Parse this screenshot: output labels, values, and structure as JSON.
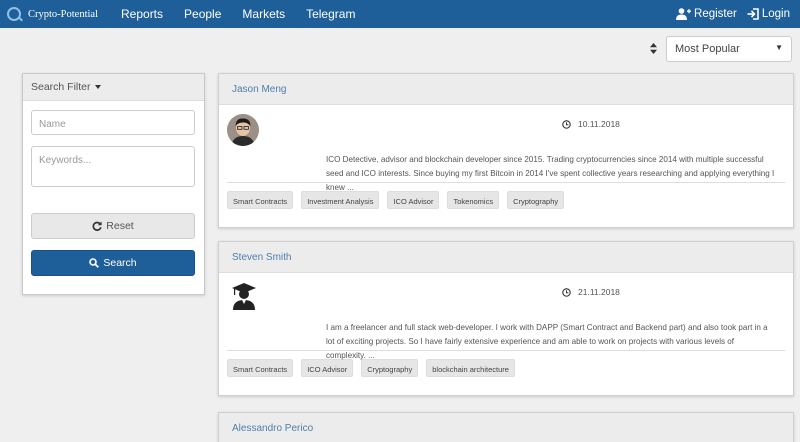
{
  "navbar": {
    "brand": "Crypto-Potential",
    "links": [
      "Reports",
      "People",
      "Markets",
      "Telegram"
    ],
    "register": "Register",
    "login": "Login"
  },
  "sort": {
    "selected": "Most Popular"
  },
  "filter": {
    "title": "Search Filter",
    "name_placeholder": "Name",
    "keywords_placeholder": "Keywords...",
    "reset_label": "Reset",
    "search_label": "Search"
  },
  "cards": [
    {
      "name": "Jason Meng",
      "date": "10.11.2018",
      "description": "ICO Detective, advisor and blockchain developer since 2015. Trading cryptocurrencies since 2014 with multiple successful seed and ICO interests. Since buying my first Bitcoin in 2014 I've spent collective years researching and applying everything I knew ...",
      "tags": [
        "Smart Contracts",
        "Investment Analysis",
        "ICO Advisor",
        "Tokenomics",
        "Cryptography"
      ]
    },
    {
      "name": "Steven Smith",
      "date": "21.11.2018",
      "description": "I am a freelancer and full stack web-developer. I work with DAPP (Smart Contract and Backend part) and also took part in a lot of exciting projects. So I have fairly extensive experience and am able to work on projects with various levels of complexity. ...",
      "tags": [
        "Smart Contracts",
        "ICO Advisor",
        "Cryptography",
        "blockchain architecture"
      ]
    },
    {
      "name": "Alessandro Perico"
    }
  ],
  "colors": {
    "navbar": "#1f5f99",
    "name_link": "#4d7fab",
    "background": "#efefef"
  }
}
